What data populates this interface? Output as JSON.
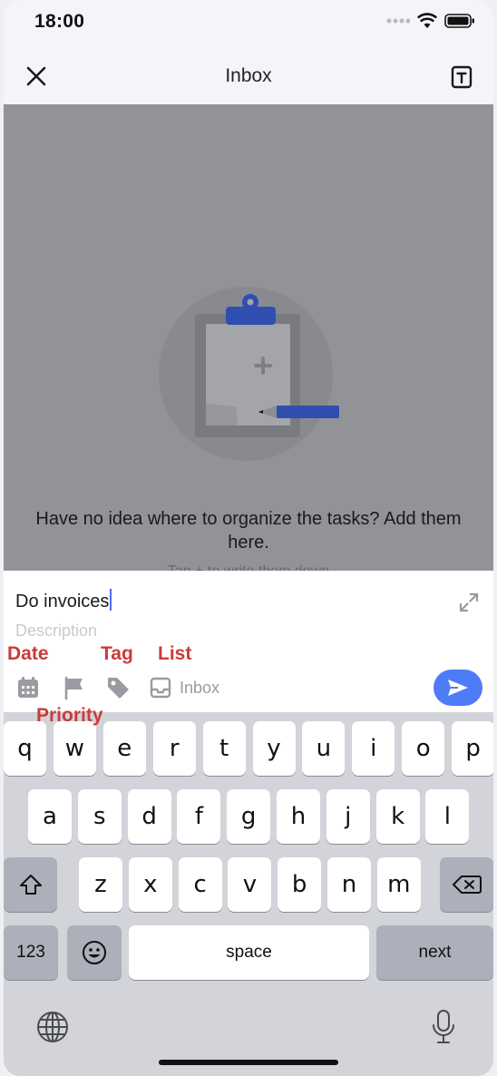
{
  "status_bar": {
    "time": "18:00"
  },
  "nav": {
    "title": "Inbox"
  },
  "empty_state": {
    "message": "Have no idea where to organize the tasks? Add them here.",
    "hint": "Tap + to write them down"
  },
  "composer": {
    "task_title": "Do invoices",
    "description_placeholder": "Description",
    "list_label": "Inbox"
  },
  "annotations": {
    "date": "Date",
    "tag": "Tag",
    "list": "List",
    "priority": "Priority"
  },
  "keyboard": {
    "row1": [
      "q",
      "w",
      "e",
      "r",
      "t",
      "y",
      "u",
      "i",
      "o",
      "p"
    ],
    "row2": [
      "a",
      "s",
      "d",
      "f",
      "g",
      "h",
      "j",
      "k",
      "l"
    ],
    "row3": [
      "z",
      "x",
      "c",
      "v",
      "b",
      "n",
      "m"
    ],
    "numbers_label": "123",
    "space_label": "space",
    "next_label": "next"
  },
  "colors": {
    "accent": "#4e7cf6",
    "annotation": "#cc3a3a",
    "overlay": "#929399",
    "clipboard_clip": "#2f4fb0"
  },
  "icons": [
    "close-icon",
    "template-icon",
    "calendar-icon",
    "flag-icon",
    "tag-icon",
    "inbox-icon",
    "send-icon",
    "expand-icon",
    "shift-icon",
    "backspace-icon",
    "emoji-icon",
    "globe-icon",
    "microphone-icon"
  ]
}
